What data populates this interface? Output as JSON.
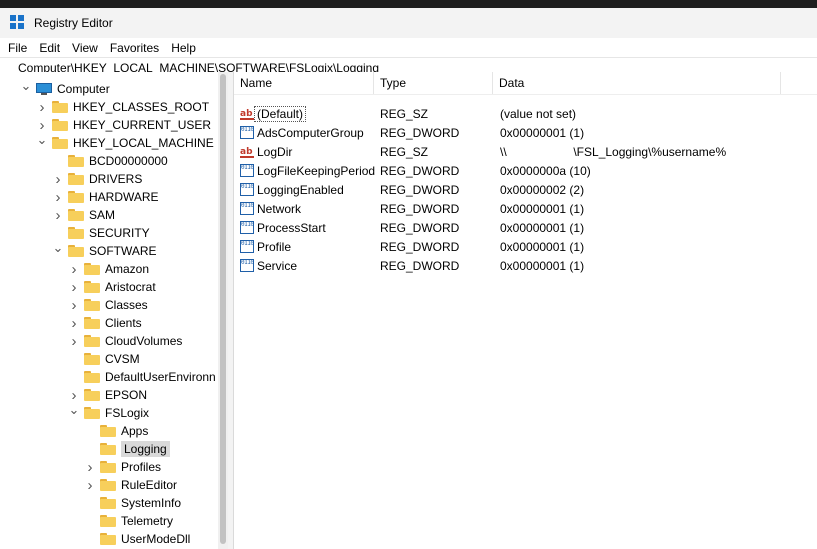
{
  "window": {
    "title": "Registry Editor"
  },
  "menu": [
    "File",
    "Edit",
    "View",
    "Favorites",
    "Help"
  ],
  "address": "Computer\\HKEY_LOCAL_MACHINE\\SOFTWARE\\FSLogix\\Logging",
  "tree": [
    {
      "label": "Computer",
      "icon": "computer-icon",
      "depth": 0,
      "chevron": "down"
    },
    {
      "label": "HKEY_CLASSES_ROOT",
      "icon": "folder-icon",
      "depth": 1,
      "chevron": "right"
    },
    {
      "label": "HKEY_CURRENT_USER",
      "icon": "folder-icon",
      "depth": 1,
      "chevron": "right"
    },
    {
      "label": "HKEY_LOCAL_MACHINE",
      "icon": "folder-icon",
      "depth": 1,
      "chevron": "down"
    },
    {
      "label": "BCD00000000",
      "icon": "folder-icon",
      "depth": 2,
      "chevron": "none"
    },
    {
      "label": "DRIVERS",
      "icon": "folder-icon",
      "depth": 2,
      "chevron": "right"
    },
    {
      "label": "HARDWARE",
      "icon": "folder-icon",
      "depth": 2,
      "chevron": "right"
    },
    {
      "label": "SAM",
      "icon": "folder-icon",
      "depth": 2,
      "chevron": "right"
    },
    {
      "label": "SECURITY",
      "icon": "folder-icon",
      "depth": 2,
      "chevron": "none"
    },
    {
      "label": "SOFTWARE",
      "icon": "folder-icon",
      "depth": 2,
      "chevron": "down"
    },
    {
      "label": "Amazon",
      "icon": "folder-icon",
      "depth": 3,
      "chevron": "right"
    },
    {
      "label": "Aristocrat",
      "icon": "folder-icon",
      "depth": 3,
      "chevron": "right"
    },
    {
      "label": "Classes",
      "icon": "folder-icon",
      "depth": 3,
      "chevron": "right"
    },
    {
      "label": "Clients",
      "icon": "folder-icon",
      "depth": 3,
      "chevron": "right"
    },
    {
      "label": "CloudVolumes",
      "icon": "folder-icon",
      "depth": 3,
      "chevron": "right"
    },
    {
      "label": "CVSM",
      "icon": "folder-icon",
      "depth": 3,
      "chevron": "none"
    },
    {
      "label": "DefaultUserEnvironn",
      "icon": "folder-icon",
      "depth": 3,
      "chevron": "none"
    },
    {
      "label": "EPSON",
      "icon": "folder-icon",
      "depth": 3,
      "chevron": "right"
    },
    {
      "label": "FSLogix",
      "icon": "folder-icon",
      "depth": 3,
      "chevron": "down"
    },
    {
      "label": "Apps",
      "icon": "folder-icon",
      "depth": 4,
      "chevron": "none"
    },
    {
      "label": "Logging",
      "icon": "folder-icon",
      "depth": 4,
      "chevron": "none",
      "selected": true
    },
    {
      "label": "Profiles",
      "icon": "folder-icon",
      "depth": 4,
      "chevron": "right"
    },
    {
      "label": "RuleEditor",
      "icon": "folder-icon",
      "depth": 4,
      "chevron": "right"
    },
    {
      "label": "SystemInfo",
      "icon": "folder-icon",
      "depth": 4,
      "chevron": "none"
    },
    {
      "label": "Telemetry",
      "icon": "folder-icon",
      "depth": 4,
      "chevron": "none"
    },
    {
      "label": "UserModeDll",
      "icon": "folder-icon",
      "depth": 4,
      "chevron": "none"
    }
  ],
  "columns": {
    "name": "Name",
    "type": "Type",
    "data": "Data"
  },
  "values": [
    {
      "name": "(Default)",
      "type": "REG_SZ",
      "data": "(value not set)",
      "icon": "string-value-icon",
      "focused": true
    },
    {
      "name": "AdsComputerGroup",
      "type": "REG_DWORD",
      "data": "0x00000001 (1)",
      "icon": "binary-value-icon"
    },
    {
      "name": "LogDir",
      "type": "REG_SZ",
      "data": "\\\\                    \\FSL_Logging\\%username%",
      "icon": "string-value-icon"
    },
    {
      "name": "LogFileKeepingPeriod",
      "type": "REG_DWORD",
      "data": "0x0000000a (10)",
      "icon": "binary-value-icon"
    },
    {
      "name": "LoggingEnabled",
      "type": "REG_DWORD",
      "data": "0x00000002 (2)",
      "icon": "binary-value-icon"
    },
    {
      "name": "Network",
      "type": "REG_DWORD",
      "data": "0x00000001 (1)",
      "icon": "binary-value-icon"
    },
    {
      "name": "ProcessStart",
      "type": "REG_DWORD",
      "data": "0x00000001 (1)",
      "icon": "binary-value-icon"
    },
    {
      "name": "Profile",
      "type": "REG_DWORD",
      "data": "0x00000001 (1)",
      "icon": "binary-value-icon"
    },
    {
      "name": "Service",
      "type": "REG_DWORD",
      "data": "0x00000001 (1)",
      "icon": "binary-value-icon"
    }
  ]
}
